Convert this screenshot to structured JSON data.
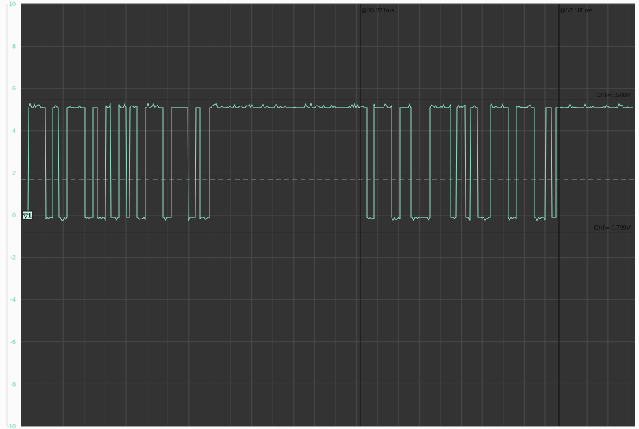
{
  "scope": {
    "y_axis": {
      "min": -10,
      "max": 10,
      "ticks": [
        "10",
        "8",
        "6",
        "4",
        "2",
        "0",
        "-2",
        "-4",
        "-6",
        "-8",
        "-10"
      ]
    },
    "time_cursors": [
      {
        "label": "@33.221ms"
      },
      {
        "label": "@52.685ms"
      }
    ],
    "level_cursors": [
      {
        "label": "Ch1=5.500V;",
        "value": 5.5
      },
      {
        "label": "Ch1=-0.799V;",
        "value": -0.799
      }
    ],
    "trigger_level": 1.7,
    "channel_marker": {
      "label": "▽1",
      "value": 0
    },
    "signal": {
      "channel": "Ch1",
      "high_v": 5.1,
      "low_v": -0.1,
      "color": "#8fe0c2"
    },
    "colors": {
      "plot_bg": "#333333",
      "grid": "#4a4a4a",
      "axis_text": "#7fd3b6",
      "cursor": "#0d0d0d",
      "trigger": "#6e6e6e",
      "marker_bg": "#c5f5e3"
    }
  }
}
